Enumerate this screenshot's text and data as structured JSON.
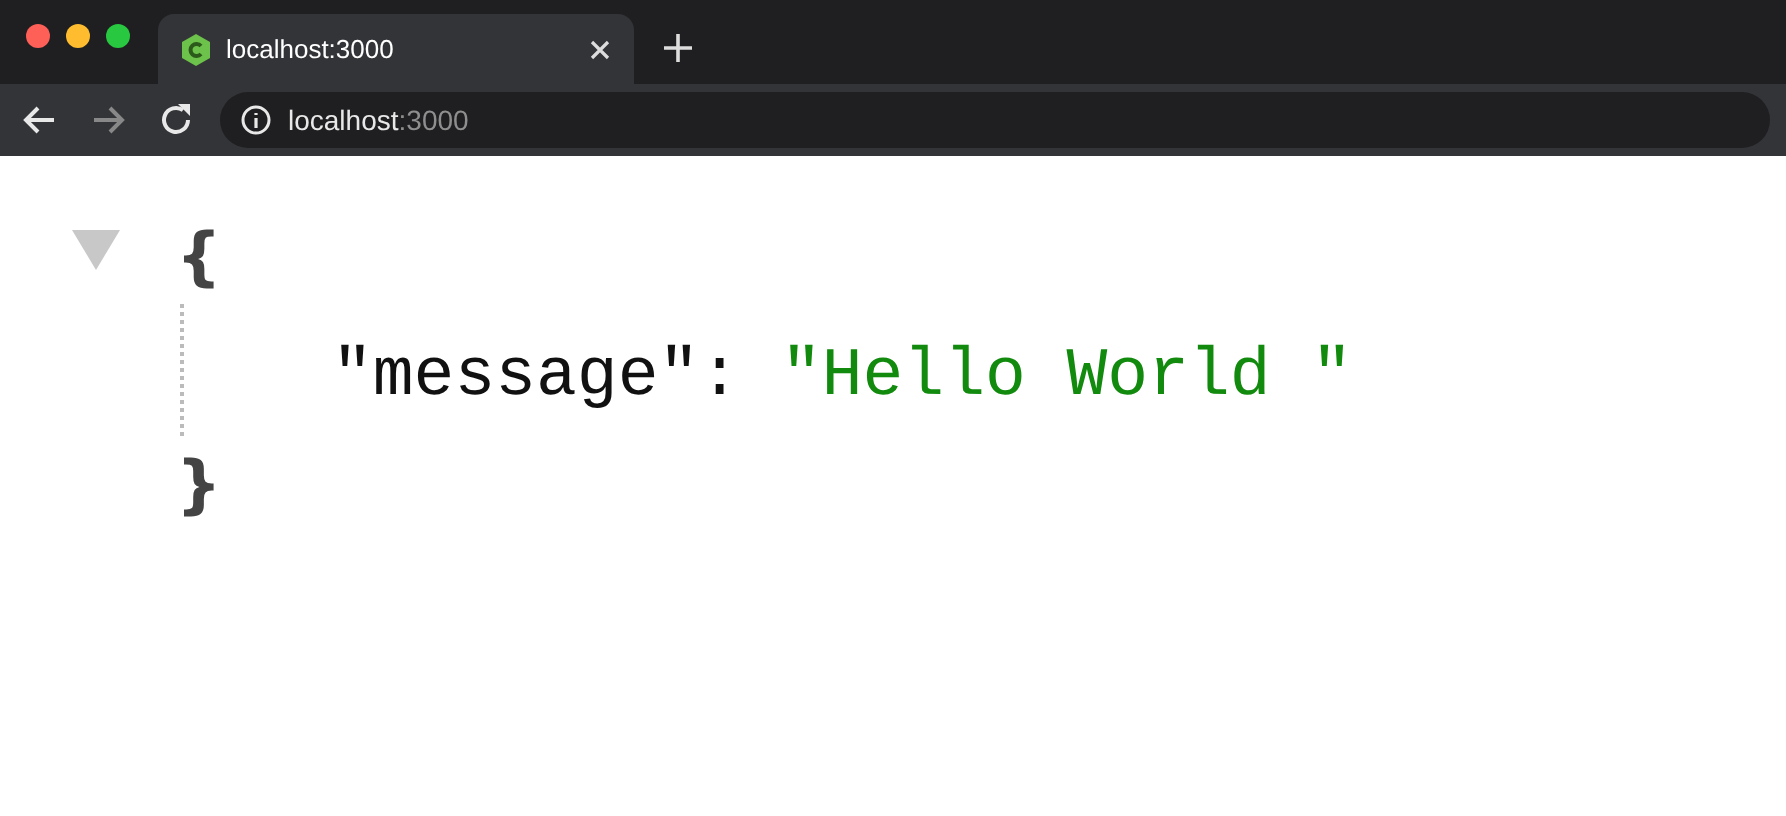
{
  "tab": {
    "title": "localhost:3000",
    "selected": true
  },
  "address_bar": {
    "host": "localhost",
    "port": ":3000"
  },
  "json_viewer": {
    "expanded": true,
    "open_brace": "{",
    "close_brace": "}",
    "entries": [
      {
        "key": "\"message\"",
        "colon": ":",
        "value": "\"Hello World \""
      }
    ]
  }
}
